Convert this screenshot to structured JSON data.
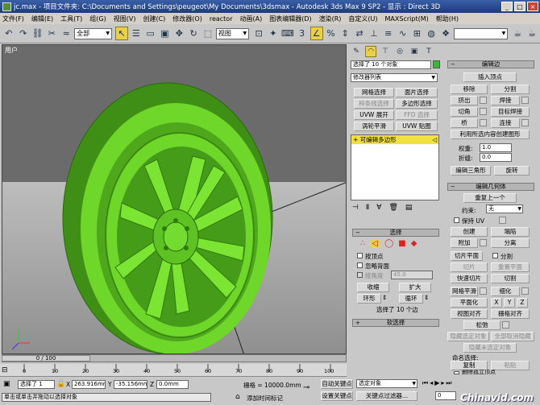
{
  "title": {
    "file": "jc.max",
    "text": "- 项目文件夹: C:\\Documents and Settings\\peugeot\\My Documents\\3dsmax - Autodesk 3ds Max 9 SP2 - 显示 : Direct 3D",
    "min": "_",
    "max": "□",
    "close": "×"
  },
  "menu": [
    "文件(F)",
    "编辑(E)",
    "工具(T)",
    "组(G)",
    "视图(V)",
    "创建(C)",
    "修改器(O)",
    "reactor",
    "动画(A)",
    "图表编辑器(D)",
    "渲染(R)",
    "自定义(U)",
    "MAXScript(M)",
    "帮助(H)"
  ],
  "toolbar": {
    "filter": "全部",
    "ref_coord": "视图"
  },
  "viewport": {
    "label": "用户",
    "colors": {
      "wheel": "#6fd62a",
      "wheel_dark": "#3f8f16",
      "bg": "#6b6b6b"
    }
  },
  "modifier": {
    "selected_count": "选择了 10 个对象",
    "list_label": "修改器列表",
    "buttons": [
      "网格选择",
      "面片选择",
      "样条线选择",
      "多边形选择",
      "UVW 展开",
      "FFD 选择",
      "涡轮平滑",
      "UVW 贴图"
    ],
    "stack_item": "可编辑多边形"
  },
  "selection": {
    "header": "选择",
    "by_vertex": "按顶点",
    "ignore_back": "忽略背面",
    "by_angle": "按角度",
    "angle": "45.0",
    "shrink": "收缩",
    "grow": "扩大",
    "ring": "环形",
    "loop": "循环",
    "count": "选择了 10 个边",
    "soft": "软选择"
  },
  "edit_edges": {
    "header": "编辑边",
    "insert_vertex": "插入顶点",
    "remove": "移除",
    "split": "分割",
    "extrude": "挤出",
    "weld": "焊接",
    "chamfer": "切角",
    "target_weld": "目标焊接",
    "bridge": "桥",
    "connect": "连接",
    "create_shape": "利用所选内容创建图形",
    "weight_label": "权重:",
    "weight": "1.0",
    "crease_label": "折缝:",
    "crease": "0.0",
    "edit_tri": "编辑三角形",
    "turn": "旋转"
  },
  "edit_geom": {
    "header": "编辑几何体",
    "repeat": "重复上一个",
    "constraint_label": "约束:",
    "constraint": "无",
    "preserve_uv": "保持 UV",
    "create": "创建",
    "collapse": "塌陷",
    "attach": "附加",
    "detach": "分离",
    "slice_plane": "切片平面",
    "split_chk": "分割",
    "slice": "切片",
    "reset_plane": "重置平面",
    "quickslice": "快速切片",
    "cut": "切割",
    "meshsmooth": "网格平滑",
    "tessellate": "细化",
    "planarize": "平面化",
    "x": "X",
    "y": "Y",
    "z": "Z",
    "view_align": "视图对齐",
    "grid_align": "栅格对齐",
    "relax": "松弛",
    "hide_sel": "隐藏选定对象",
    "unhide_all": "全部取消隐藏",
    "hide_unsel": "隐藏未选定对象",
    "named_sel": "命名选择:",
    "copy": "复制",
    "paste": "粘贴",
    "delete_iso": "删除孤立顶点"
  },
  "timeline": {
    "frames": "0 / 100",
    "ticks": [
      "0",
      "10",
      "20",
      "30",
      "40",
      "50",
      "60",
      "70",
      "80",
      "90",
      "100"
    ]
  },
  "status": {
    "selected": "选择了 1",
    "x": "263.916mm",
    "y": "-35.156mm",
    "z": "0.0mm",
    "grid": "栅格 = 10000.0mm",
    "autokey": "自动关键点",
    "setkey": "设置关键点",
    "key_mode": "选定对象",
    "key_filter": "关键点过滤器...",
    "prompt": "单击或单击并拖动以选择对象",
    "add_tag": "添加时间标记",
    "frame": "0"
  },
  "watermark": "Chinavid.com"
}
